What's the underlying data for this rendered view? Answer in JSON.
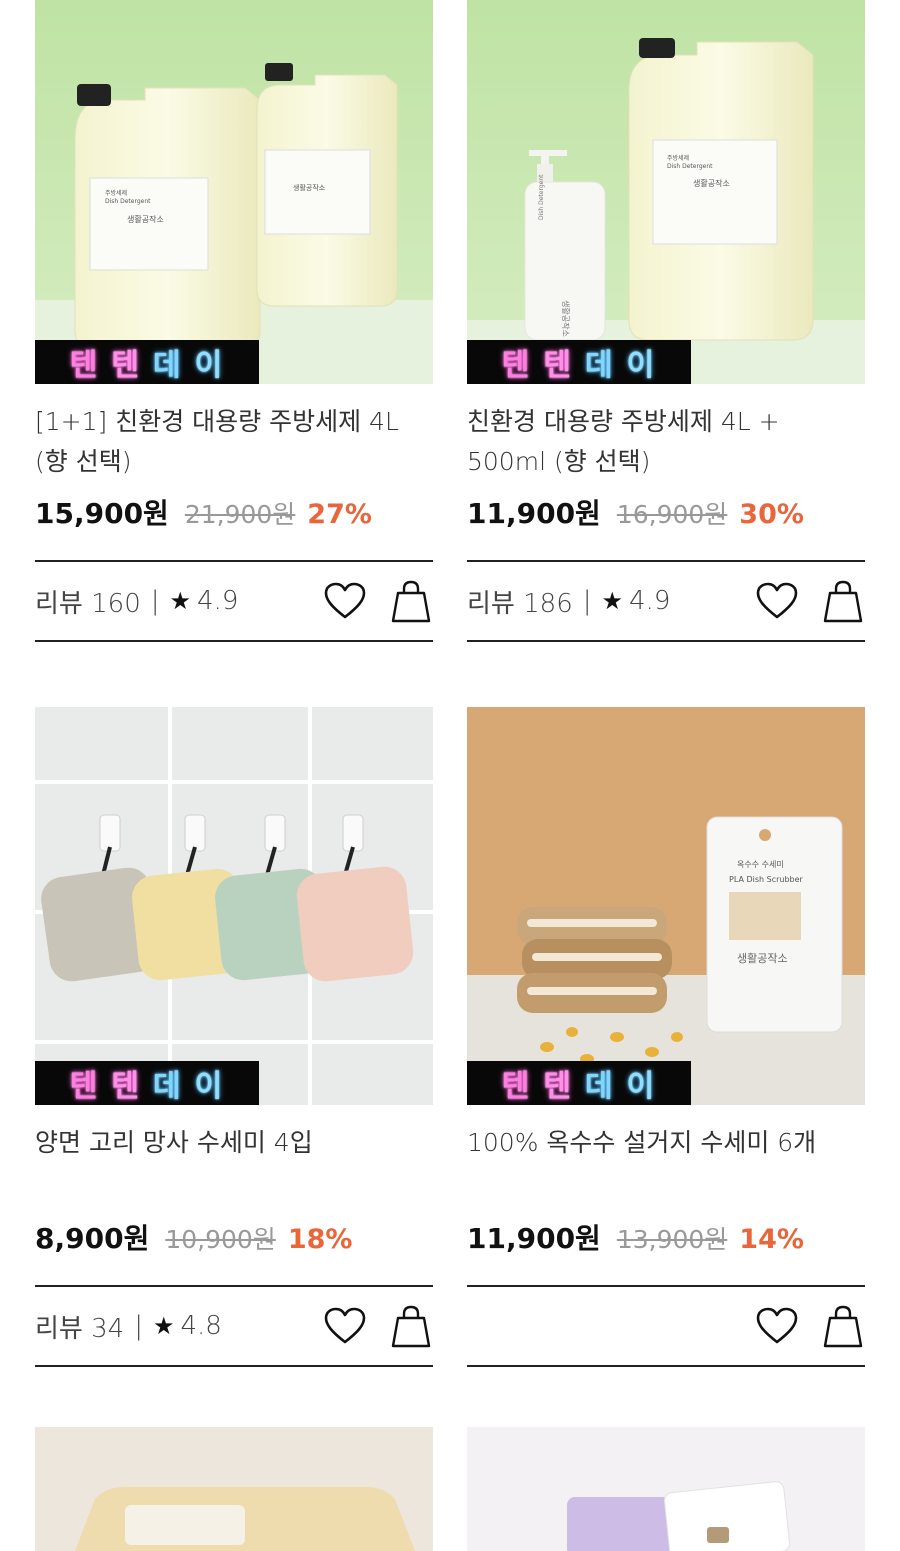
{
  "products": [
    {
      "title": "[1+1] 친환경 대용량 주방세제 4L (향 선택)",
      "price": "15,900원",
      "original_price": "21,900원",
      "discount": "27%",
      "badge": [
        "텐",
        "텐",
        "데",
        "이"
      ],
      "review_label": "리뷰 160",
      "rating": "4.9",
      "image_desc": "detergent-jugs"
    },
    {
      "title": "친환경 대용량 주방세제 4L + 500ml (향 선택)",
      "price": "11,900원",
      "original_price": "16,900원",
      "discount": "30%",
      "badge": [
        "텐",
        "텐",
        "데",
        "이"
      ],
      "review_label": "리뷰 186",
      "rating": "4.9",
      "image_desc": "detergent-jug-pump"
    },
    {
      "title": "양면 고리 망사 수세미 4입",
      "price": "8,900원",
      "original_price": "10,900원",
      "discount": "18%",
      "badge": [
        "텐",
        "텐",
        "데",
        "이"
      ],
      "review_label": "리뷰 34",
      "rating": "4.8",
      "image_desc": "mesh-scrubbers"
    },
    {
      "title": "100% 옥수수 설거지 수세미 6개",
      "price": "11,900원",
      "original_price": "13,900원",
      "discount": "14%",
      "badge": [
        "텐",
        "텐",
        "데",
        "이"
      ],
      "review_label": "",
      "rating": "",
      "image_desc": "corn-scrubbers"
    }
  ],
  "image_labels": {
    "jug_ko": "주방세제",
    "jug_en": "Dish Detergent",
    "jug_brand": "생활공작소",
    "pack_ko": "옥수수 수세미",
    "pack_en": "PLA Dish Scrubber",
    "pack_brand": "생활공작소"
  },
  "colors": {
    "accent_discount": "#e8663a",
    "badge_bg": "#080808",
    "badge_pink": "#ff7fe0",
    "badge_blue": "#7fd6ff"
  },
  "icons": [
    "star-icon",
    "heart-icon",
    "shopping-bag-icon"
  ]
}
